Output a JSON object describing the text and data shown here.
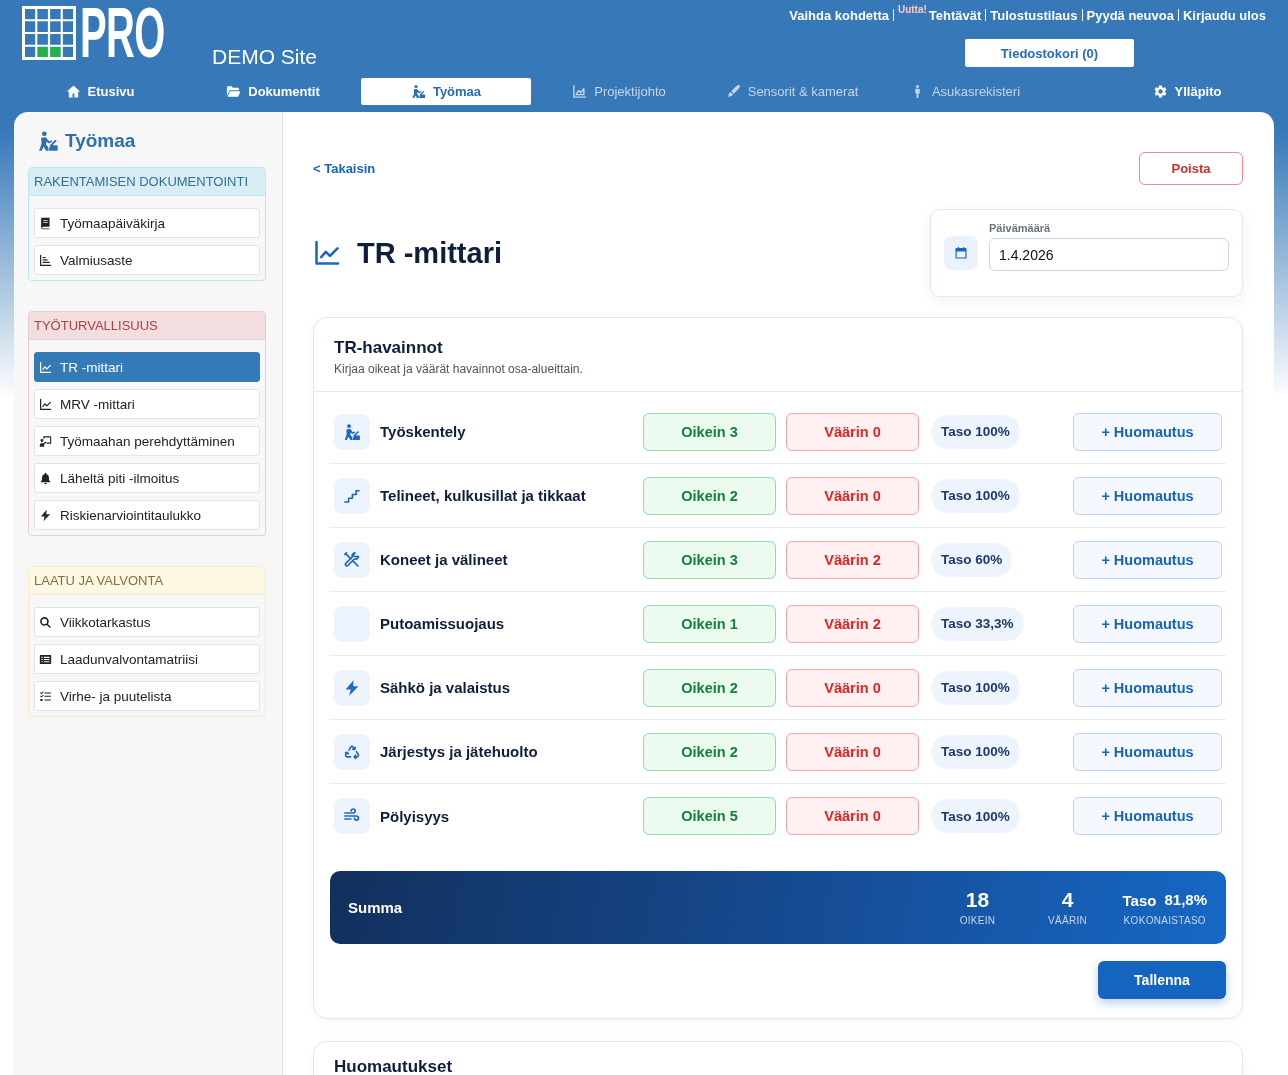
{
  "header": {
    "logo_text": "PRO",
    "site_name": "DEMO Site",
    "top_links": [
      {
        "label": "Vaihda kohdetta"
      },
      {
        "label": "Tehtävät",
        "badge": "Uutta!"
      },
      {
        "label": "Tulostustilaus"
      },
      {
        "label": "Pyydä neuvoa"
      },
      {
        "label": "Kirjaudu ulos"
      }
    ],
    "cart_button": "Tiedostokori (0)"
  },
  "nav": [
    {
      "label": "Etusivu",
      "selected": false,
      "disabled": false
    },
    {
      "label": "Dokumentit",
      "selected": false,
      "disabled": false
    },
    {
      "label": "Työmaa",
      "selected": true,
      "disabled": false
    },
    {
      "label": "Projektijohto",
      "selected": false,
      "disabled": true
    },
    {
      "label": "Sensorit & kamerat",
      "selected": false,
      "disabled": true
    },
    {
      "label": "Asukasrekisteri",
      "selected": false,
      "disabled": true
    },
    {
      "label": "Ylläpito",
      "selected": false,
      "disabled": false
    }
  ],
  "sidebar": {
    "title": "Työmaa",
    "sections": [
      {
        "title": "RAKENTAMISEN DOKUMENTOINTI",
        "kind": "info",
        "items": [
          {
            "label": "Työmaapäiväkirja",
            "selected": false
          },
          {
            "label": "Valmiusaste",
            "selected": false
          }
        ]
      },
      {
        "title": "TYÖTURVALLISUUS",
        "kind": "danger",
        "items": [
          {
            "label": "TR -mittari",
            "selected": true
          },
          {
            "label": "MRV -mittari",
            "selected": false
          },
          {
            "label": "Työmaahan perehdyttäminen",
            "selected": false
          },
          {
            "label": "Läheltä piti -ilmoitus",
            "selected": false
          },
          {
            "label": "Riskienarviointitaulukko",
            "selected": false
          }
        ]
      },
      {
        "title": "LAATU JA VALVONTA",
        "kind": "warning",
        "items": [
          {
            "label": "Viikkotarkastus",
            "selected": false
          },
          {
            "label": "Laadunvalvontamatriisi",
            "selected": false
          },
          {
            "label": "Virhe- ja puutelista",
            "selected": false
          }
        ]
      }
    ]
  },
  "page": {
    "back_link": "< Takaisin",
    "delete_button": "Poista",
    "title": "TR -mittari",
    "date": {
      "label": "Päivämäärä",
      "value": "1.4.2026"
    }
  },
  "observations": {
    "title": "TR-havainnot",
    "subtitle": "Kirjaa oikeat ja väärät havainnot osa-alueittain.",
    "rows": [
      {
        "name": "Työskentely",
        "correct": "Oikein 3",
        "wrong": "Väärin 0",
        "level_text": "Taso 100%",
        "note_button": "+ Huomautus"
      },
      {
        "name": "Telineet, kulkusillat ja tikkaat",
        "correct": "Oikein 2",
        "wrong": "Väärin 0",
        "level_text": "Taso 100%",
        "note_button": "+ Huomautus"
      },
      {
        "name": "Koneet ja välineet",
        "correct": "Oikein 3",
        "wrong": "Väärin 2",
        "level_text": "Taso 60%",
        "note_button": "+ Huomautus"
      },
      {
        "name": "Putoamissuojaus",
        "correct": "Oikein 1",
        "wrong": "Väärin 2",
        "level_text": "Taso 33,3%",
        "note_button": "+ Huomautus"
      },
      {
        "name": "Sähkö ja valaistus",
        "correct": "Oikein 2",
        "wrong": "Väärin 0",
        "level_text": "Taso 100%",
        "note_button": "+ Huomautus"
      },
      {
        "name": "Järjestys ja jätehuolto",
        "correct": "Oikein 2",
        "wrong": "Väärin 0",
        "level_text": "Taso 100%",
        "note_button": "+ Huomautus"
      },
      {
        "name": "Pölyisyys",
        "correct": "Oikein 5",
        "wrong": "Väärin 0",
        "level_text": "Taso 100%",
        "note_button": "+ Huomautus"
      }
    ],
    "summary": {
      "label": "Summa",
      "stats": [
        {
          "value": "18",
          "caption": "OIKEIN"
        },
        {
          "value": "4",
          "caption": "VÄÄRIN"
        },
        {
          "prefix": "Taso",
          "value": "81,8%",
          "caption": "KOKONAISTASO"
        }
      ]
    },
    "save_button": "Tallenna"
  },
  "notes": {
    "title": "Huomautukset"
  }
}
